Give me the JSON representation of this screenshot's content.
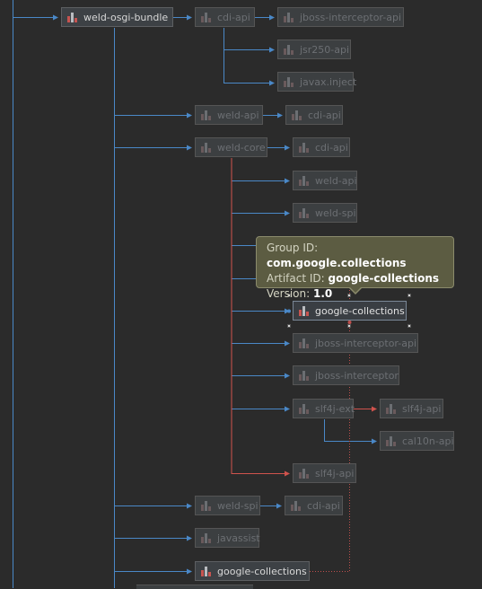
{
  "colors": {
    "blue_edge": "#4a88c7",
    "red_edge": "#d0534d",
    "dotted_edge": "#c0504d",
    "background": "#2b2b2b"
  },
  "nodes": {
    "weld_osgi_bundle": "weld-osgi-bundle",
    "cdi_api_1": "cdi-api",
    "jboss_interceptor_api_1": "jboss-interceptor-api",
    "jsr250_api": "jsr250-api",
    "javax_inject": "javax.inject",
    "weld_api_1": "weld-api",
    "cdi_api_2": "cdi-api",
    "weld_core": "weld-core",
    "cdi_api_3": "cdi-api",
    "weld_api_2": "weld-api",
    "weld_spi_1": "weld-spi",
    "google_collections_selected": "google-collections",
    "jboss_interceptor_api_2": "jboss-interceptor-api",
    "jboss_interceptor": "jboss-interceptor",
    "slf4j_ext": "slf4j-ext",
    "slf4j_api_1": "slf4j-api",
    "cal10n_api": "cal10n-api",
    "slf4j_api_2": "slf4j-api",
    "weld_spi_2": "weld-spi",
    "cdi_api_4": "cdi-api",
    "javassist": "javassist",
    "google_collections_bottom": "google-collections"
  },
  "tooltip": {
    "group_label": "Group ID: ",
    "group_value": "com.google.collections",
    "artifact_label": "Artifact ID: ",
    "artifact_value": "google-collections",
    "version_label": "Version: ",
    "version_value": "1.0"
  }
}
